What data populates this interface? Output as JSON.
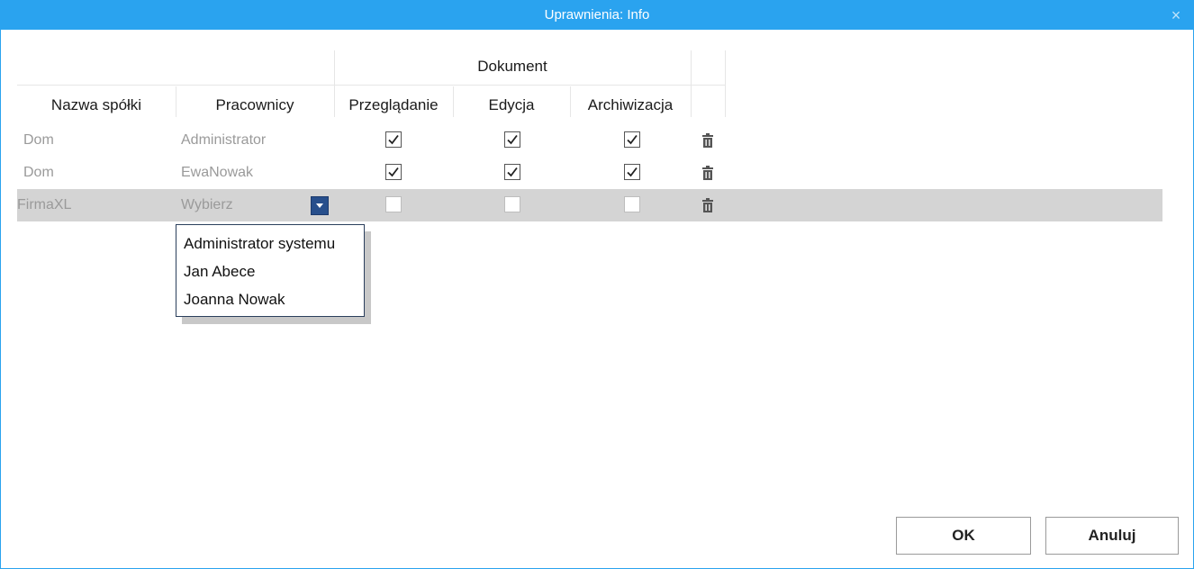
{
  "dialog": {
    "title": "Uprawnienia: Info",
    "close_symbol": "×"
  },
  "table": {
    "group_header": "Dokument",
    "columns": {
      "company": "Nazwa spółki",
      "employees": "Pracownicy",
      "view": "Przeglądanie",
      "edit": "Edycja",
      "archive": "Archiwizacja"
    },
    "rows": [
      {
        "company": "Dom",
        "employee": "Administrator",
        "view": true,
        "edit": true,
        "archive": true,
        "selected": false
      },
      {
        "company": "Dom",
        "employee": "EwaNowak",
        "view": true,
        "edit": true,
        "archive": true,
        "selected": false
      },
      {
        "company": "FirmaXL",
        "employee": "Wybierz",
        "view": false,
        "edit": false,
        "archive": false,
        "selected": true
      }
    ]
  },
  "employee_dropdown": {
    "open": true,
    "options": [
      "Administrator systemu",
      "Jan Abece",
      "Joanna Nowak"
    ]
  },
  "buttons": {
    "ok_label": "OK",
    "cancel_label": "Anuluj"
  },
  "icons": {
    "close": "close-icon",
    "checkmark": "checkmark-icon",
    "delete": "trash-icon",
    "dropdown": "chevron-down-icon"
  },
  "colors": {
    "titlebar": "#2aa3ef",
    "selected_row": "#d4d4d4",
    "dropdown_button": "#274f8c"
  }
}
